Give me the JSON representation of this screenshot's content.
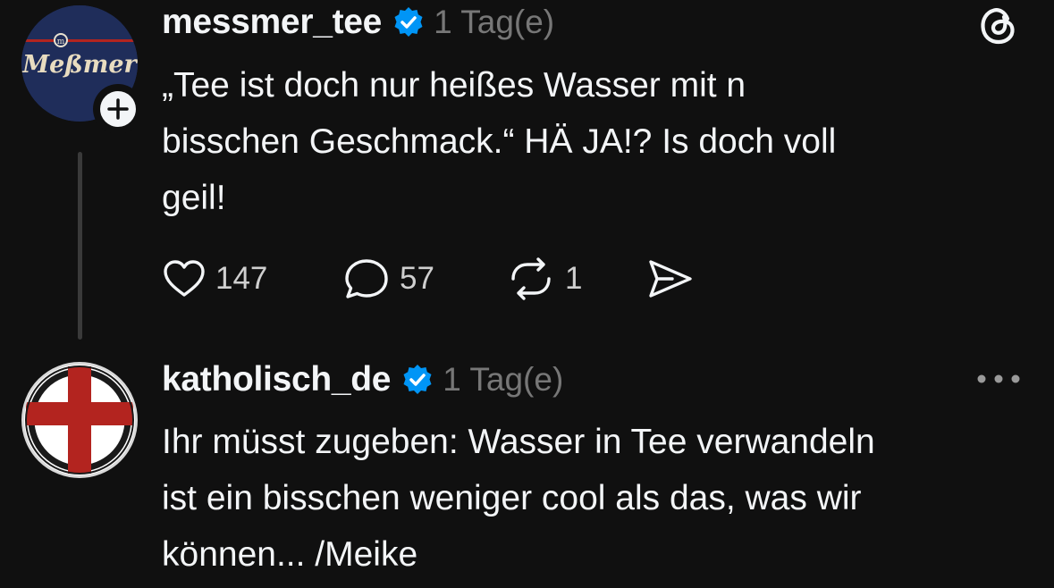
{
  "posts": [
    {
      "username": "messmer_tee",
      "timestamp": "1 Tag(e)",
      "avatar_text": "Meßmer",
      "verified": true,
      "text_lines": [
        "„Tee ist doch nur heißes Wasser mit n",
        "bisschen Geschmack.“ HÄ JA!? Is doch voll",
        "geil!"
      ],
      "stats": {
        "likes": "147",
        "replies": "57",
        "reposts": "1"
      }
    },
    {
      "username": "katholisch_de",
      "timestamp": "1 Tag(e)",
      "verified": true,
      "text_lines": [
        "Ihr müsst zugeben: Wasser in Tee verwandeln",
        "ist ein bisschen weniger cool als das, was wir",
        "können... /Meike"
      ]
    }
  ],
  "icons": {
    "app_logo": "threads-logo-icon",
    "follow": "plus-icon",
    "verified": "verified-badge-icon",
    "like": "heart-icon",
    "reply": "speech-bubble-icon",
    "repost": "repost-icon",
    "share": "send-icon",
    "more": "more-horizontal-icon"
  },
  "colors": {
    "background": "#101010",
    "text": "#f3f5f7",
    "muted": "#777777",
    "verified": "#0095f6",
    "messmer_brand": "#1f2d5a",
    "katholisch_cross": "#b3241f"
  }
}
